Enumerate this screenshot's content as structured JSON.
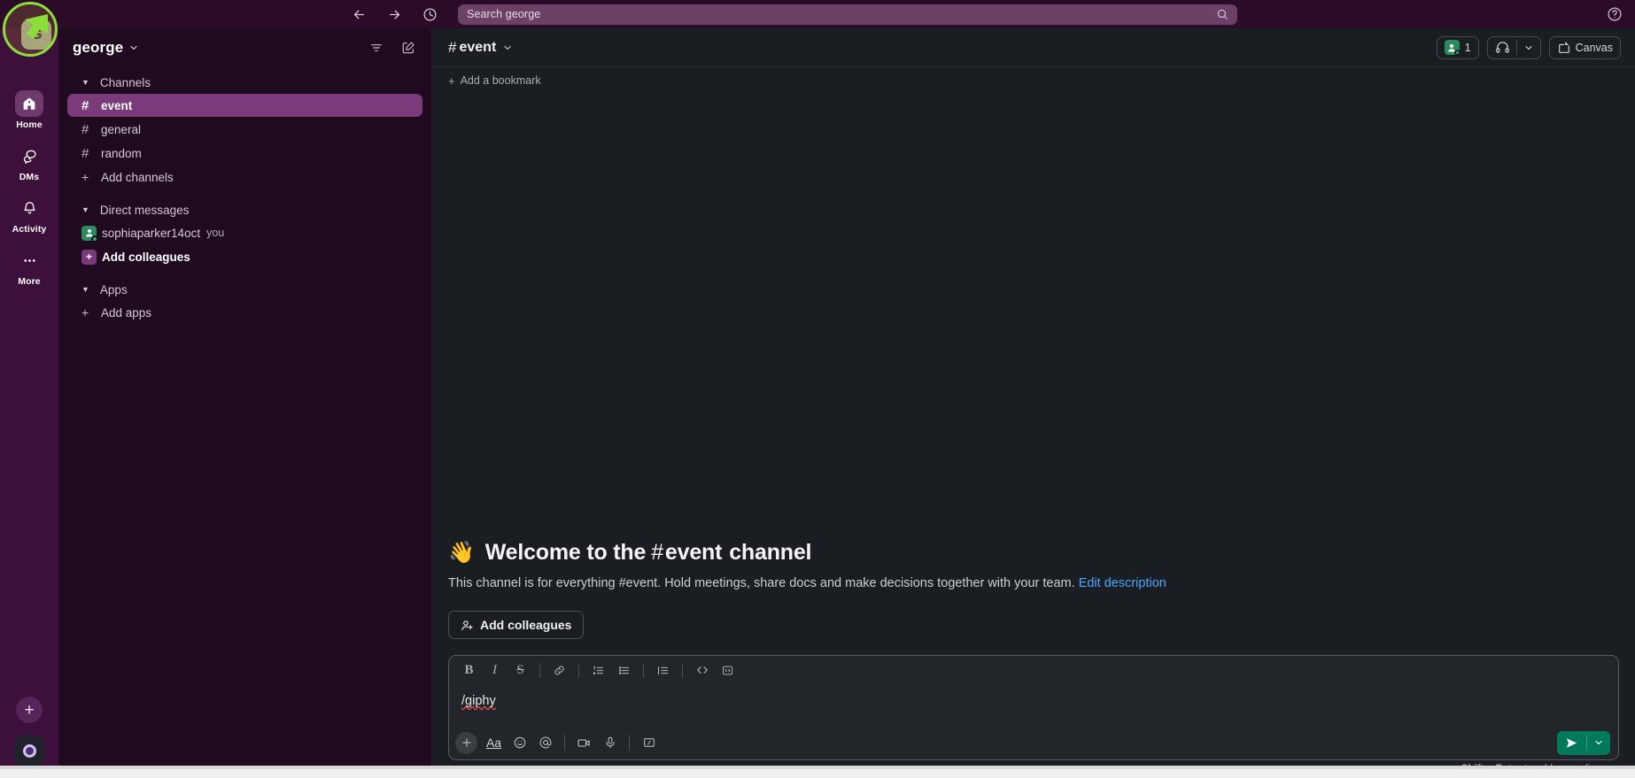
{
  "topbar": {
    "back_icon": "arrow-left-icon",
    "forward_icon": "arrow-right-icon",
    "history_icon": "clock-icon",
    "search_placeholder": "Search george",
    "search_icon": "search-icon",
    "help_icon": "help-icon"
  },
  "rail": {
    "workspace_initial": "G",
    "items": [
      {
        "label": "Home",
        "icon": "home-icon",
        "active": true
      },
      {
        "label": "DMs",
        "icon": "dms-icon",
        "active": false
      },
      {
        "label": "Activity",
        "icon": "bell-icon",
        "active": false
      },
      {
        "label": "More",
        "icon": "ellipsis-icon",
        "active": false
      }
    ],
    "new_button_icon": "plus-icon",
    "avatar_icon": "user-avatar"
  },
  "sidebar": {
    "workspace_name": "george",
    "workspace_chevron_icon": "chevron-down-icon",
    "filter_icon": "filter-icon",
    "compose_icon": "compose-icon",
    "sections": [
      {
        "name": "Channels",
        "caret_icon": "caret-down-icon",
        "items": [
          {
            "label": "event",
            "prefix": "#",
            "selected": true,
            "type": "channel"
          },
          {
            "label": "general",
            "prefix": "#",
            "selected": false,
            "type": "channel"
          },
          {
            "label": "random",
            "prefix": "#",
            "selected": false,
            "type": "channel"
          },
          {
            "label": "Add channels",
            "prefix": "+",
            "selected": false,
            "type": "action"
          }
        ]
      },
      {
        "name": "Direct messages",
        "caret_icon": "caret-down-icon",
        "items": [
          {
            "label": "sophiaparker14oct",
            "suffix": "you",
            "selected": false,
            "type": "dm"
          },
          {
            "label": "Add colleagues",
            "selected": false,
            "type": "add"
          }
        ]
      },
      {
        "name": "Apps",
        "caret_icon": "caret-down-icon",
        "items": [
          {
            "label": "Add apps",
            "prefix": "+",
            "selected": false,
            "type": "action"
          }
        ]
      }
    ]
  },
  "channel": {
    "name": "event",
    "hash": "#",
    "chevron_icon": "chevron-down-icon",
    "members_count": "1",
    "members_icon": "member-icon",
    "huddle_icon": "headphones-icon",
    "huddle_chevron_icon": "chevron-down-icon",
    "canvas_label": "Canvas",
    "canvas_icon": "canvas-icon",
    "bookmark_label": "Add a bookmark",
    "bookmark_plus": "+"
  },
  "welcome": {
    "wave_emoji": "👋",
    "title_prefix": "Welcome to the",
    "hash": "#",
    "channel_name": "event",
    "title_suffix": "channel",
    "description": "This channel is for everything #event. Hold meetings, share docs and make decisions together with your team.",
    "edit_link": "Edit description",
    "add_colleagues_label": "Add colleagues",
    "add_colleagues_icon": "person-plus-icon"
  },
  "composer": {
    "value": "/giphy",
    "format_buttons": [
      {
        "name": "bold-button",
        "glyph": "B"
      },
      {
        "name": "italic-button",
        "glyph": "I"
      },
      {
        "name": "strikethrough-button",
        "glyph": "S"
      },
      {
        "name": "link-button",
        "glyph": "link-icon"
      },
      {
        "name": "ordered-list-button",
        "glyph": "ordered-list-icon"
      },
      {
        "name": "bulleted-list-button",
        "glyph": "bulleted-list-icon"
      },
      {
        "name": "blockquote-button",
        "glyph": "blockquote-icon"
      },
      {
        "name": "code-button",
        "glyph": "code-icon"
      },
      {
        "name": "code-block-button",
        "glyph": "code-block-icon"
      }
    ],
    "action_buttons": [
      {
        "name": "attach-button",
        "glyph": "plus-icon"
      },
      {
        "name": "formatting-button",
        "glyph": "Aa"
      },
      {
        "name": "emoji-button",
        "glyph": "emoji-icon"
      },
      {
        "name": "mention-button",
        "glyph": "at-icon"
      },
      {
        "name": "video-button",
        "glyph": "video-icon"
      },
      {
        "name": "audio-button",
        "glyph": "mic-icon"
      },
      {
        "name": "slash-command-button",
        "glyph": "slash-icon"
      }
    ],
    "send_icon": "send-icon",
    "send_chevron_icon": "chevron-down-icon",
    "hint_bold": "Shift + Enter",
    "hint_rest": " to add a new line"
  },
  "colors": {
    "sidebar_bg": "#1f0a20",
    "rail_bg": "#3d0f3b",
    "topbar_bg": "#2a0c29",
    "selected_channel": "#7b3b7a",
    "main_bg": "#1a1d21",
    "send_green": "#007a5a",
    "link_blue": "#4ea6ff",
    "cursor_green": "#8ede3a"
  }
}
